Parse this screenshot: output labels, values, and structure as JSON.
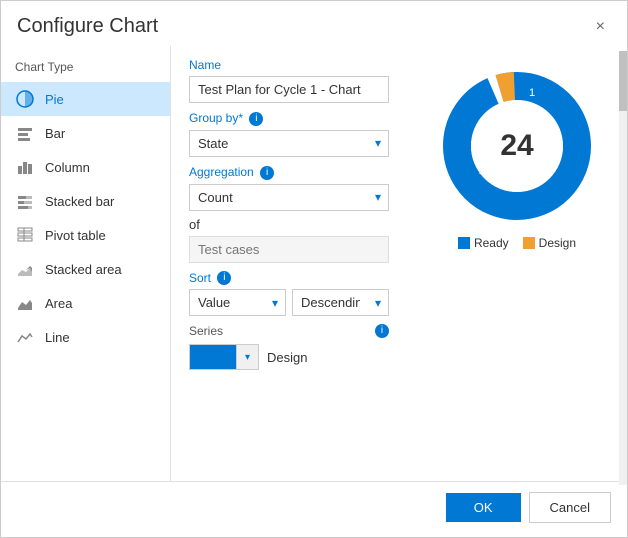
{
  "dialog": {
    "title": "Configure Chart",
    "close_label": "×"
  },
  "chart_type": {
    "label": "Chart Type",
    "items": [
      {
        "id": "pie",
        "label": "Pie",
        "icon": "pie"
      },
      {
        "id": "bar",
        "label": "Bar",
        "icon": "bar"
      },
      {
        "id": "column",
        "label": "Column",
        "icon": "column"
      },
      {
        "id": "stacked-bar",
        "label": "Stacked bar",
        "icon": "stacked-bar"
      },
      {
        "id": "pivot-table",
        "label": "Pivot table",
        "icon": "pivot"
      },
      {
        "id": "stacked-area",
        "label": "Stacked area",
        "icon": "stacked-area"
      },
      {
        "id": "area",
        "label": "Area",
        "icon": "area"
      },
      {
        "id": "line",
        "label": "Line",
        "icon": "line"
      }
    ],
    "selected": "pie"
  },
  "form": {
    "name_label": "Name",
    "name_value": "Test Plan for Cycle 1 - Chart",
    "group_by_label": "Group by*",
    "group_by_value": "State",
    "aggregation_label": "Aggregation",
    "aggregation_value": "Count",
    "of_label": "of",
    "of_placeholder": "Test cases",
    "sort_label": "Sort",
    "sort_value": "Value",
    "sort_order_value": "Descending",
    "series_label": "Series",
    "series_info": "i",
    "series_name": "Design"
  },
  "chart": {
    "total": "24",
    "segments": [
      {
        "label": "Ready",
        "value": 23,
        "color": "#0078d4",
        "angle": 345
      },
      {
        "label": "Design",
        "value": 1,
        "color": "#f0a030",
        "angle": 15
      }
    ]
  },
  "footer": {
    "ok_label": "OK",
    "cancel_label": "Cancel"
  }
}
